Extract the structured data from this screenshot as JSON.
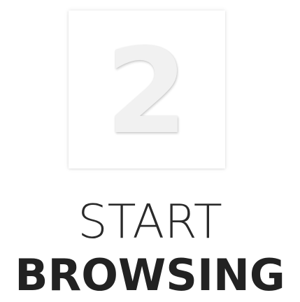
{
  "step": {
    "number": "2"
  },
  "heading": {
    "line1": "START",
    "line2": "BROWSING"
  },
  "colors": {
    "background": "#ffffff",
    "card": "#ffffff",
    "number_fill": "#f1f1f1",
    "text": "#222222"
  }
}
